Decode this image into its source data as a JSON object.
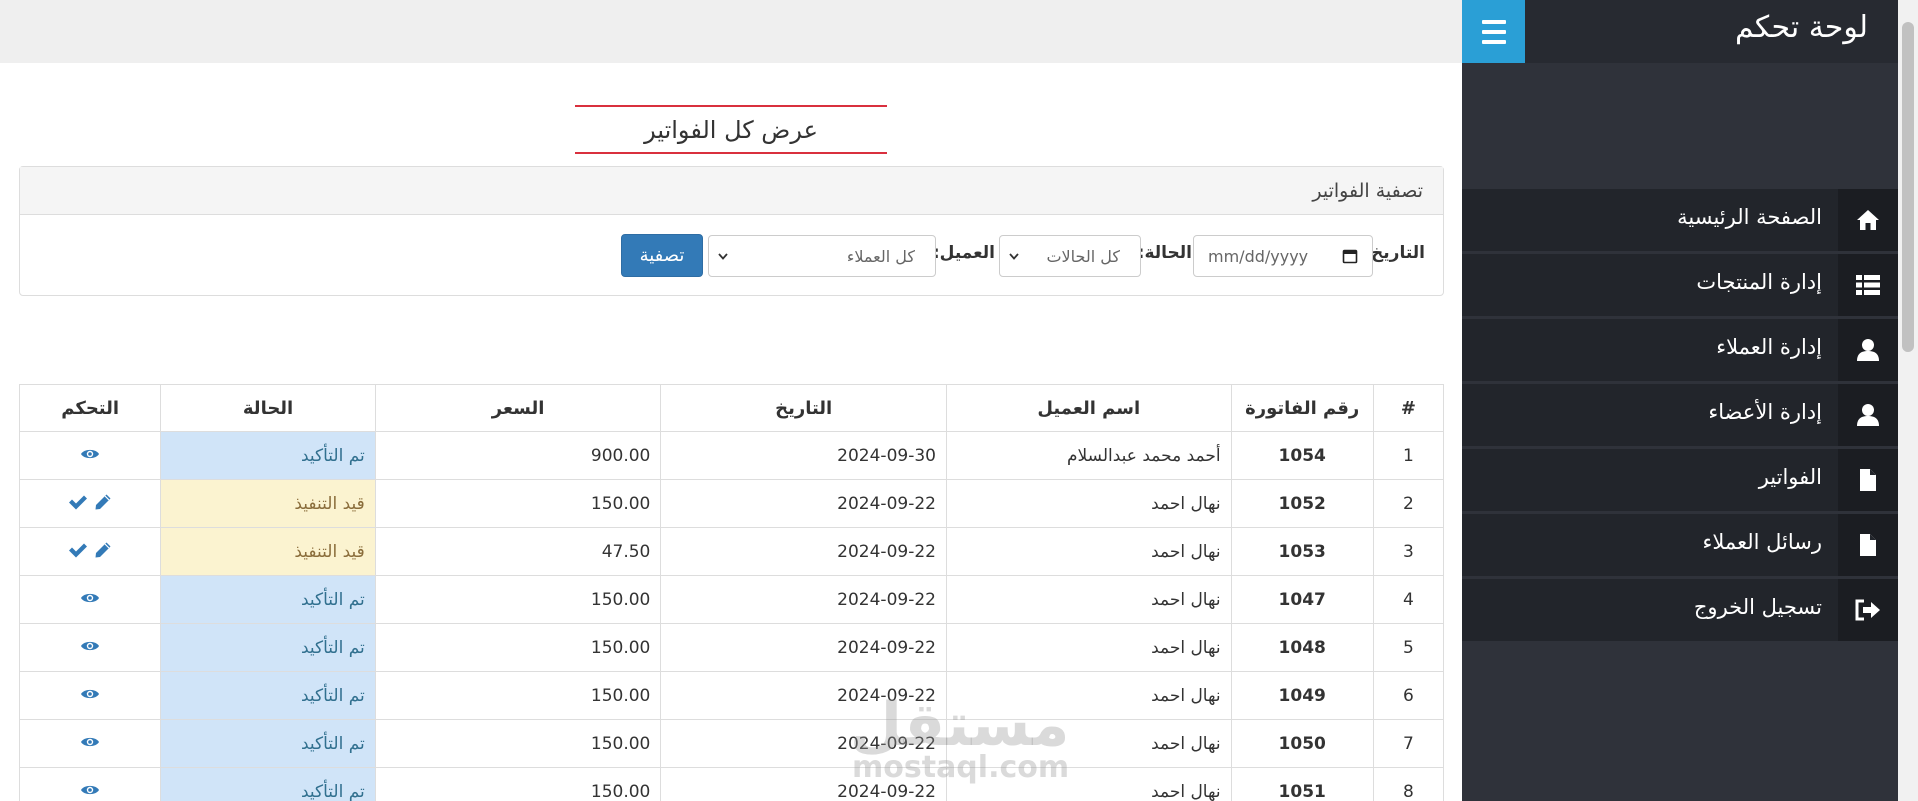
{
  "sidebar": {
    "title": "لوحة تحكم",
    "items": [
      {
        "label": "الصفحة الرئيسية",
        "icon": "home-icon"
      },
      {
        "label": "إدارة المنتجات",
        "icon": "list-icon"
      },
      {
        "label": "إدارة العملاء",
        "icon": "user-icon"
      },
      {
        "label": "إدارة الأعضاء",
        "icon": "user-icon"
      },
      {
        "label": "الفواتير",
        "icon": "file-icon"
      },
      {
        "label": "رسائل العملاء",
        "icon": "file-icon"
      },
      {
        "label": "تسجيل الخروج",
        "icon": "logout-icon"
      }
    ]
  },
  "page": {
    "title": "عرض كل الفواتير"
  },
  "filter": {
    "heading": "تصفية الفواتير",
    "date_label": "التاريخ:",
    "date_placeholder": "mm/dd/yyyy",
    "status_label": "الحالة:",
    "status_value": "كل الحالات",
    "client_label": "العميل:",
    "client_value": "كل العملاء",
    "submit_label": "تصفية"
  },
  "table": {
    "headers": [
      "#",
      "رقم الفاتورة",
      "اسم العميل",
      "التاريخ",
      "السعر",
      "الحالة",
      "التحكم"
    ],
    "rows": [
      {
        "num": "1",
        "invoice": "1054",
        "client": "أحمد محمد عبدالسلام",
        "date": "2024-09-30",
        "price": "900.00",
        "status": "تم التأكيد",
        "state": "confirmed"
      },
      {
        "num": "2",
        "invoice": "1052",
        "client": "نهال احمد",
        "date": "2024-09-22",
        "price": "150.00",
        "status": "قيد التنفيذ",
        "state": "pending"
      },
      {
        "num": "3",
        "invoice": "1053",
        "client": "نهال احمد",
        "date": "2024-09-22",
        "price": "47.50",
        "status": "قيد التنفيذ",
        "state": "pending"
      },
      {
        "num": "4",
        "invoice": "1047",
        "client": "نهال احمد",
        "date": "2024-09-22",
        "price": "150.00",
        "status": "تم التأكيد",
        "state": "confirmed"
      },
      {
        "num": "5",
        "invoice": "1048",
        "client": "نهال احمد",
        "date": "2024-09-22",
        "price": "150.00",
        "status": "تم التأكيد",
        "state": "confirmed"
      },
      {
        "num": "6",
        "invoice": "1049",
        "client": "نهال احمد",
        "date": "2024-09-22",
        "price": "150.00",
        "status": "تم التأكيد",
        "state": "confirmed"
      },
      {
        "num": "7",
        "invoice": "1050",
        "client": "نهال احمد",
        "date": "2024-09-22",
        "price": "150.00",
        "status": "تم التأكيد",
        "state": "confirmed"
      },
      {
        "num": "8",
        "invoice": "1051",
        "client": "نهال احمد",
        "date": "2024-09-22",
        "price": "150.00",
        "status": "تم التأكيد",
        "state": "confirmed"
      }
    ]
  },
  "watermark": {
    "text": "مستقل",
    "sub": "mostaql.com"
  },
  "colors": {
    "accent": "#2a9fd6",
    "primary_button": "#337ab7",
    "title_underline": "#d9303e",
    "confirmed_bg": "#d0e4f8",
    "pending_bg": "#fbf3d0",
    "icon_blue": "#337ab7"
  }
}
